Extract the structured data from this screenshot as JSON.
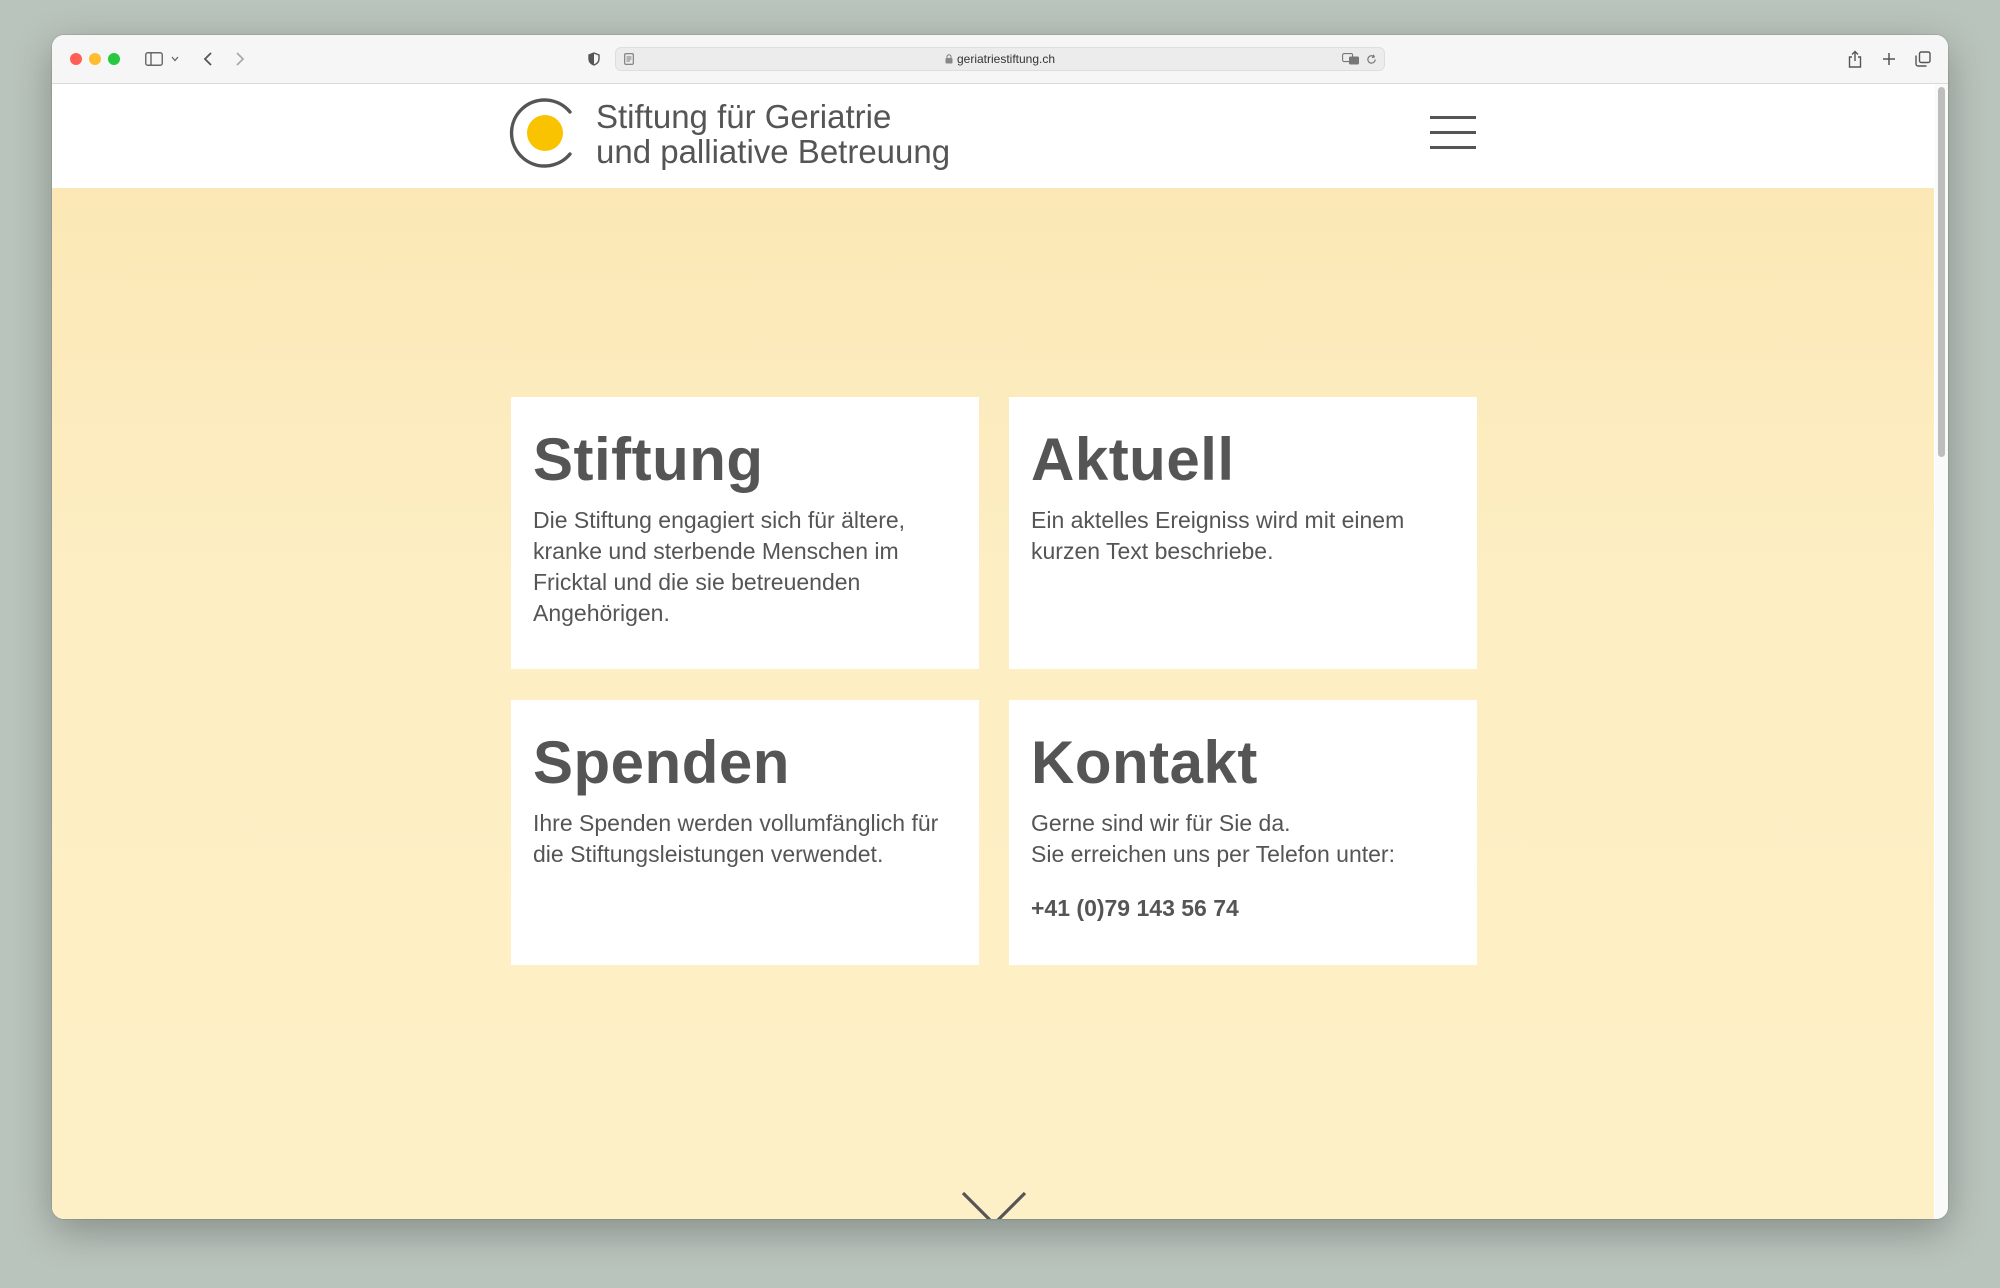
{
  "browser": {
    "url": "geriatriestiftung.ch",
    "icons": [
      "sidebar-icon",
      "chevron-down-icon",
      "back-icon",
      "forward-icon",
      "shield-icon",
      "reader-icon",
      "lock-icon",
      "translate-icon",
      "reload-icon",
      "share-icon",
      "new-tab-icon",
      "tabs-overview-icon"
    ]
  },
  "header": {
    "brand_line1": "Stiftung für Geriatrie",
    "brand_line2": "und palliative Betreuung",
    "logo_color": "#f9c300",
    "menu_icon": "hamburger-menu-icon"
  },
  "cards": {
    "stiftung": {
      "title": "Stiftung",
      "text": "Die Stiftung engagiert sich für ältere, kranke und sterbende Menschen im Fricktal und die sie betreuenden Angehörigen."
    },
    "aktuell": {
      "title": "Aktuell",
      "text": "Ein aktelles Ereigniss wird mit einem kurzen Text beschriebe."
    },
    "spenden": {
      "title": "Spenden",
      "text": "Ihre Spenden werden vollumfänglich für die Stiftungsleistungen verwendet."
    },
    "kontakt": {
      "title": "Kontakt",
      "line1": "Gerne sind wir für Sie da.",
      "line2": "Sie erreichen uns per Telefon unter:",
      "phone": "+41 (0)79 143 56 74"
    }
  },
  "colors": {
    "hero_bg": "#fdeec4",
    "text": "#555555",
    "accent": "#f9c300"
  }
}
